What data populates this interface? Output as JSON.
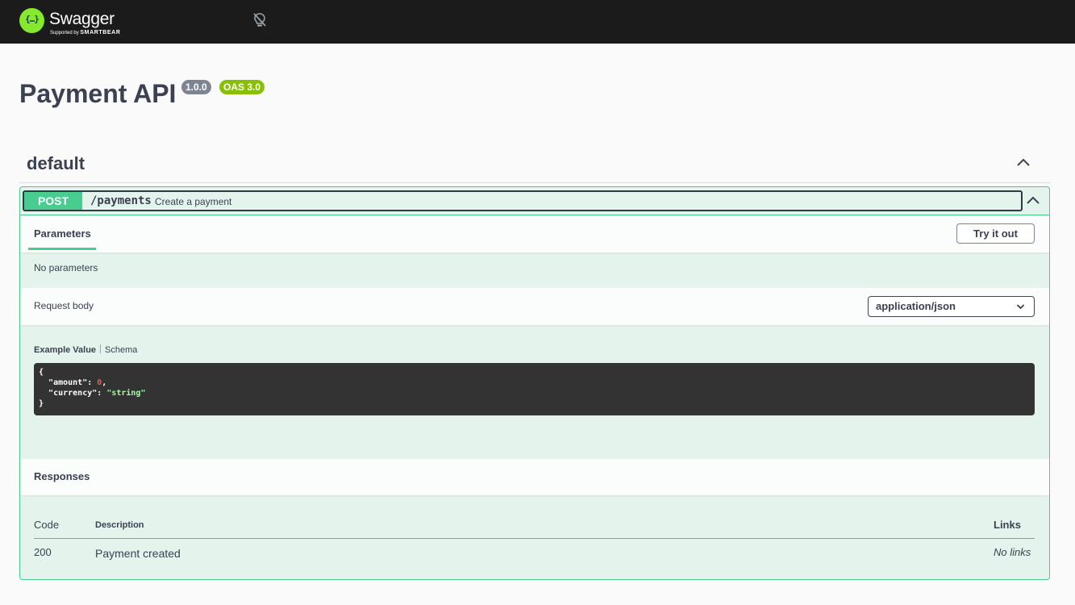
{
  "topbar": {
    "logo_glyph": "{…}",
    "brand": "Swagger",
    "supported_by": "Supported by",
    "smartbear": "SMARTBEAR"
  },
  "info": {
    "title": "Payment API",
    "version": "1.0.0",
    "oas": "OAS 3.0"
  },
  "tag": {
    "name": "default"
  },
  "operation": {
    "method": "POST",
    "path": "/payments",
    "summary": "Create a payment",
    "parameters_tab": "Parameters",
    "try_it_out": "Try it out",
    "no_parameters": "No parameters",
    "request_body_label": "Request body",
    "content_type": "application/json",
    "example_value_tab": "Example Value",
    "schema_tab": "Schema",
    "example": {
      "open": "{",
      "amount_key": "\"amount\"",
      "amount_value": "0",
      "currency_key": "\"currency\"",
      "currency_value": "\"string\"",
      "close": "}"
    },
    "responses": {
      "title": "Responses",
      "columns": {
        "code": "Code",
        "description": "Description",
        "links": "Links"
      },
      "rows": [
        {
          "code": "200",
          "description": "Payment created",
          "links": "No links"
        }
      ]
    }
  },
  "colors": {
    "topbar": "#1b1b1b",
    "logo": "#85ea2d",
    "post": "#49cc90",
    "version_badge": "#7d8492",
    "oas_badge": "#89bf04",
    "code_bg": "#333333"
  },
  "icons": {
    "logo": "swagger-logo-icon",
    "theme": "lightbulb-off-icon",
    "collapse": "chevron-up-icon",
    "select": "chevron-down-icon"
  }
}
